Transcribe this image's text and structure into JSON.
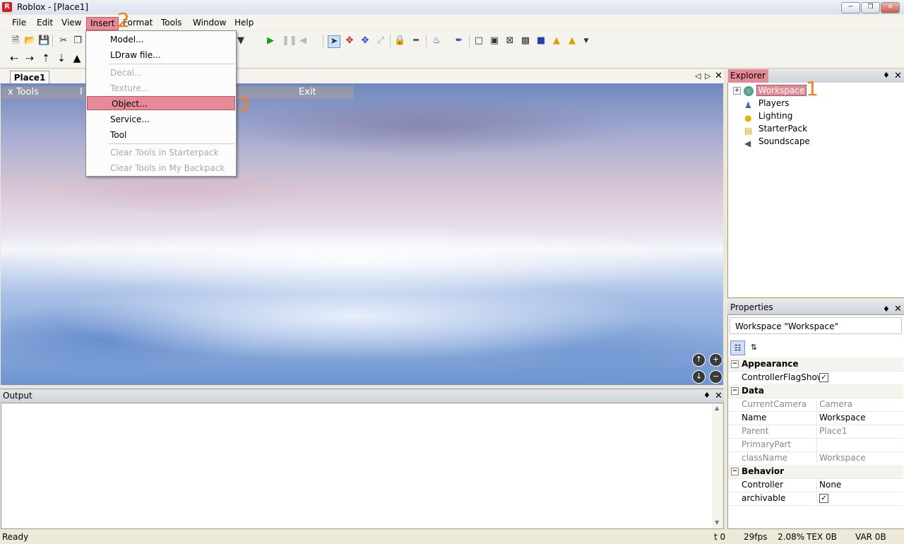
{
  "window": {
    "title": "Roblox - [Place1]",
    "app_icon": "R"
  },
  "menu": [
    "File",
    "Edit",
    "View",
    "Insert",
    "Format",
    "Tools",
    "Window",
    "Help"
  ],
  "insert_menu": {
    "items": [
      {
        "label": "Model...",
        "enabled": true
      },
      {
        "label": "LDraw file...",
        "enabled": true
      },
      {
        "label": "Decal...",
        "enabled": false
      },
      {
        "label": "Texture...",
        "enabled": false
      },
      {
        "label": "Object...",
        "enabled": true,
        "highlighted": true
      },
      {
        "label": "Service...",
        "enabled": true
      },
      {
        "label": "Tool",
        "enabled": true
      },
      {
        "label": "Clear Tools in Starterpack",
        "enabled": false
      },
      {
        "label": "Clear Tools in My Backpack",
        "enabled": false
      }
    ]
  },
  "annotations": [
    "1",
    "2",
    "3"
  ],
  "document_tab": "Place1",
  "viewport_bar": {
    "tools": "x Tools",
    "insert_fragment": "I",
    "exit": "Exit"
  },
  "explorer": {
    "title": "Explorer",
    "items": [
      "Workspace",
      "Players",
      "Lighting",
      "StarterPack",
      "Soundscape"
    ]
  },
  "properties": {
    "title": "Properties",
    "selected": "Workspace \"Workspace\"",
    "categories": {
      "appearance": "Appearance",
      "data": "Data",
      "behavior": "Behavior"
    },
    "rows": {
      "controller_flag_show": {
        "name": "ControllerFlagShow",
        "value": "✓"
      },
      "current_camera": {
        "name": "CurrentCamera",
        "value": "Camera"
      },
      "name": {
        "name": "Name",
        "value": "Workspace"
      },
      "parent": {
        "name": "Parent",
        "value": "Place1"
      },
      "primary_part": {
        "name": "PrimaryPart",
        "value": ""
      },
      "class_name": {
        "name": "className",
        "value": "Workspace"
      },
      "controller": {
        "name": "Controller",
        "value": "None"
      },
      "archivable": {
        "name": "archivable",
        "value": "✓"
      }
    }
  },
  "output": {
    "title": "Output"
  },
  "status": {
    "ready": "Ready",
    "t": "t 0",
    "fps": "29fps",
    "pct": "2.08%",
    "tex": "TEX 0B",
    "var": "VAR 0B"
  },
  "colors": {
    "highlight": "#e58a96",
    "annotation": "#f08020"
  }
}
